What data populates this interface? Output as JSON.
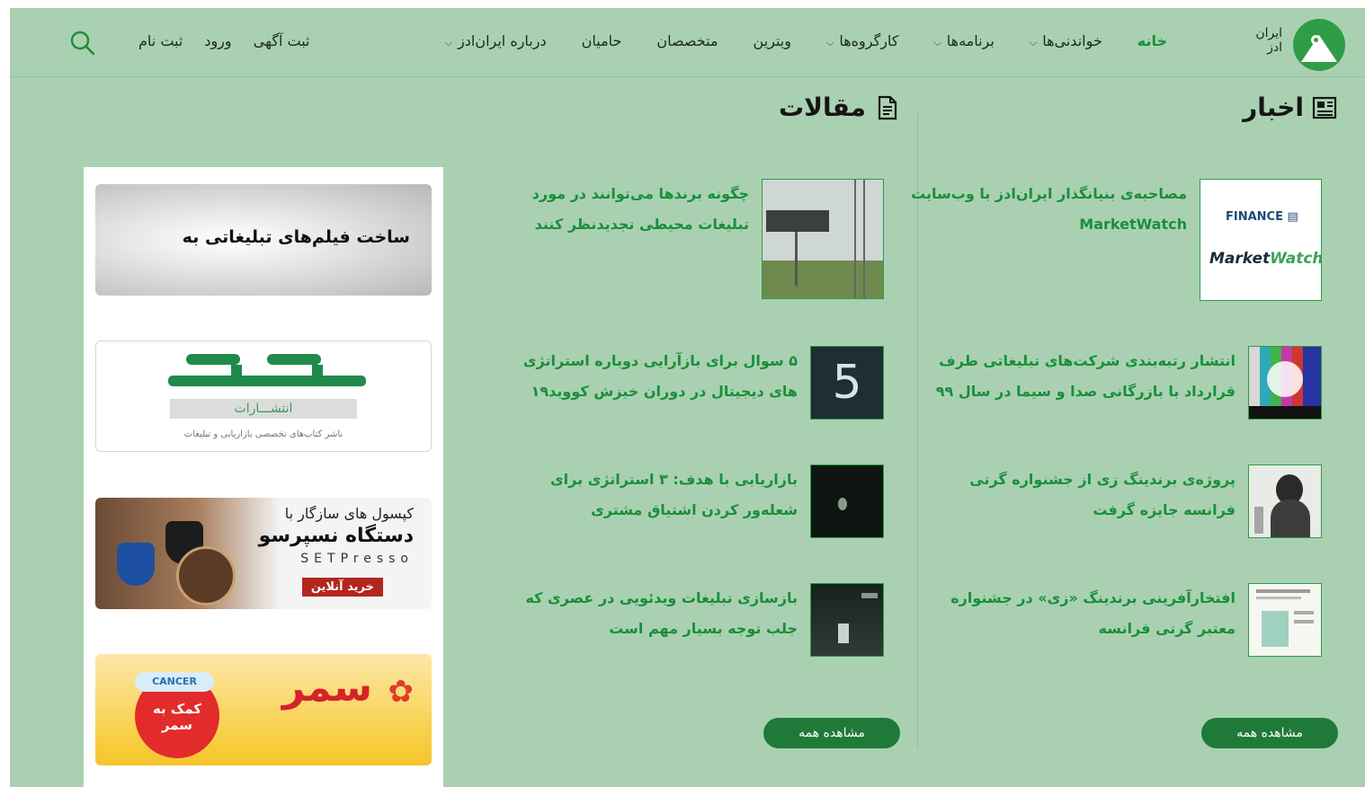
{
  "header": {
    "logo_text": "ایران\nادز",
    "nav": [
      {
        "label": "خانه",
        "active": true,
        "has_caret": false
      },
      {
        "label": "خواندنی‌ها",
        "active": false,
        "has_caret": true
      },
      {
        "label": "برنامه‌ها",
        "active": false,
        "has_caret": true
      },
      {
        "label": "کارگروه‌ها",
        "active": false,
        "has_caret": true
      },
      {
        "label": "ویترین",
        "active": false,
        "has_caret": false
      },
      {
        "label": "متخصصان",
        "active": false,
        "has_caret": false
      },
      {
        "label": "حامیان",
        "active": false,
        "has_caret": false
      },
      {
        "label": "درباره ایران‌ادز",
        "active": false,
        "has_caret": true
      }
    ],
    "auth": {
      "post_ad": "ثبت آگهی",
      "login": "ورود",
      "register": "ثبت نام"
    },
    "search_icon": "search-icon"
  },
  "news": {
    "title": "اخبار",
    "icon": "newspaper-icon",
    "items": [
      {
        "title": "مصاحبه‌ی بنیانگذار ایران‌ادز با وب‌سایت MarketWatch",
        "thumb": "finance-marketwatch"
      },
      {
        "title": "انتشار رتبه‌بندی شرکت‌های تبلیغاتی طرف قرارداد با بازرگانی صدا و سیما در سال ۹۹",
        "thumb": "irib-logo"
      },
      {
        "title": "پروژه‌ی برندینگ زی از جشنواره گرتی فرانسه جایزه گرفت",
        "thumb": "woman-portrait"
      },
      {
        "title": "افتخارآفرینی برندینگ «زی» در جشنواره معتبر گرتی فرانسه",
        "thumb": "document-page"
      }
    ],
    "view_all": "مشاهده همه"
  },
  "articles": {
    "title": "مقالات",
    "icon": "document-icon",
    "items": [
      {
        "title": "چگونه برندها می‌توانند در مورد تبلیغات محیطی تجدیدنظر کنند",
        "thumb": "billboard"
      },
      {
        "title": "۵ سوال برای بازآرایی دوباره استراتژی های دیجیتال در دوران خیزش کووید۱۹",
        "thumb": "number-5",
        "thumb_text": "5"
      },
      {
        "title": "بازاریابی با هدف: ۳ استراتژی برای شعله‌ور کردن اشتیاق مشتری",
        "thumb": "dark-flame"
      },
      {
        "title": "بازسازی تبلیغات ویدئویی در عصری که جلب توجه بسیار مهم است",
        "thumb": "dark-figure"
      }
    ],
    "view_all": "مشاهده همه"
  },
  "ads": {
    "ad1": {
      "text": "ساخت فیلم‌های تبلیغاتی به"
    },
    "ad2": {
      "sub": "انتشـــارات",
      "caption": "ناشر کتاب‌های تخصصی بازاریابی و تبلیغات"
    },
    "ad3": {
      "line1": "کپسول های سازگار با",
      "line2": "دستگاه نسپرسو",
      "line3": "SETPresso",
      "buy": "خرید آنلاین"
    },
    "ad4": {
      "brand": "سمر",
      "pill": "CANCER",
      "badge": "کمک به\nسمر"
    }
  },
  "colors": {
    "background": "#a9d1b1",
    "accent_green": "#1a8f3a",
    "button_green": "#1f7a3a"
  }
}
